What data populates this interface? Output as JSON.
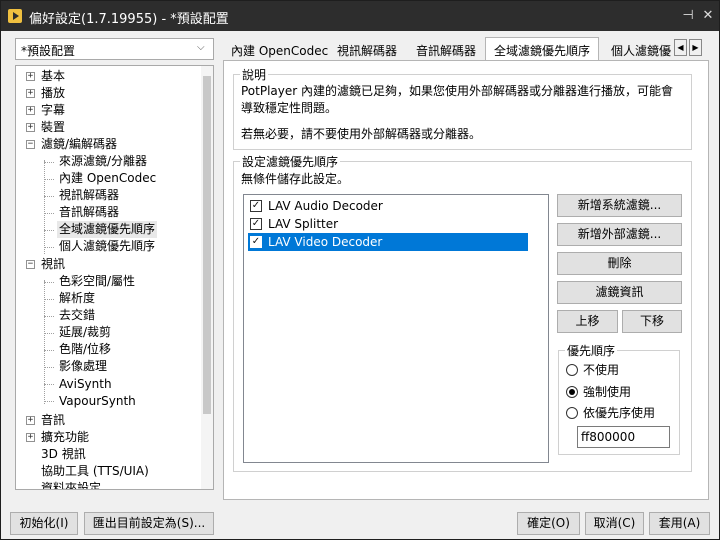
{
  "window": {
    "title": "偏好設定(1.7.19955) - *預設配置",
    "pin_glyph": "⊣",
    "close_glyph": "✕"
  },
  "preset": {
    "value": "*預設配置",
    "arrow": "⌵"
  },
  "tree": {
    "expand_glyph": "+",
    "collapse_glyph": "−",
    "items": [
      {
        "label": "基本"
      },
      {
        "label": "播放"
      },
      {
        "label": "字幕"
      },
      {
        "label": "裝置"
      },
      {
        "label": "濾鏡/編解碼器"
      },
      {
        "label": "來源濾鏡/分離器"
      },
      {
        "label": "內建 OpenCodec"
      },
      {
        "label": "視訊解碼器"
      },
      {
        "label": "音訊解碼器"
      },
      {
        "label": "全域濾鏡優先順序"
      },
      {
        "label": "個人濾鏡優先順序"
      },
      {
        "label": "視訊"
      },
      {
        "label": "色彩空間/屬性"
      },
      {
        "label": "解析度"
      },
      {
        "label": "去交錯"
      },
      {
        "label": "延展/裁剪"
      },
      {
        "label": "色階/位移"
      },
      {
        "label": "影像處理"
      },
      {
        "label": "AviSynth"
      },
      {
        "label": "VapourSynth"
      },
      {
        "label": "音訊"
      },
      {
        "label": "擴充功能"
      },
      {
        "label": "3D 視訊"
      },
      {
        "label": "協助工具 (TTS/UIA)"
      },
      {
        "label": "資料夾設定"
      }
    ]
  },
  "tabs": {
    "items": [
      {
        "label": "內建 OpenCodec"
      },
      {
        "label": "視訊解碼器"
      },
      {
        "label": "音訊解碼器"
      },
      {
        "label": "全域濾鏡優先順序"
      },
      {
        "label": "個人濾鏡優"
      }
    ],
    "prev_glyph": "◀",
    "next_glyph": "▶"
  },
  "description": {
    "legend": "說明",
    "line1": "PotPlayer 內建的濾鏡已足夠，如果您使用外部解碼器或分離器進行播放，可能會",
    "line2": "導致穩定性問題。",
    "line3": "若無必要，請不要使用外部解碼器或分離器。"
  },
  "priority": {
    "legend": "設定濾鏡優先順序",
    "note": "無條件儲存此設定。",
    "check_glyph": "✓",
    "filters": [
      {
        "label": "LAV Audio Decoder",
        "checked": true
      },
      {
        "label": "LAV Splitter",
        "checked": true
      },
      {
        "label": "LAV Video Decoder",
        "checked": true
      }
    ],
    "buttons": {
      "add_system": "新增系統濾鏡...",
      "add_external": "新增外部濾鏡...",
      "delete": "刪除",
      "filter_info": "濾鏡資訊",
      "move_up": "上移",
      "move_down": "下移"
    }
  },
  "order": {
    "legend": "優先順序",
    "options": [
      {
        "label": "不使用",
        "selected": false
      },
      {
        "label": "強制使用",
        "selected": true
      },
      {
        "label": "依優先序使用",
        "selected": false
      }
    ],
    "value": "ff800000"
  },
  "footer": {
    "initialize": "初始化(I)",
    "export": "匯出目前設定為(S)...",
    "ok": "確定(O)",
    "cancel": "取消(C)",
    "apply": "套用(A)"
  },
  "colors": {
    "selection": "#0078d7",
    "titlebar": "#2d2d2d"
  }
}
